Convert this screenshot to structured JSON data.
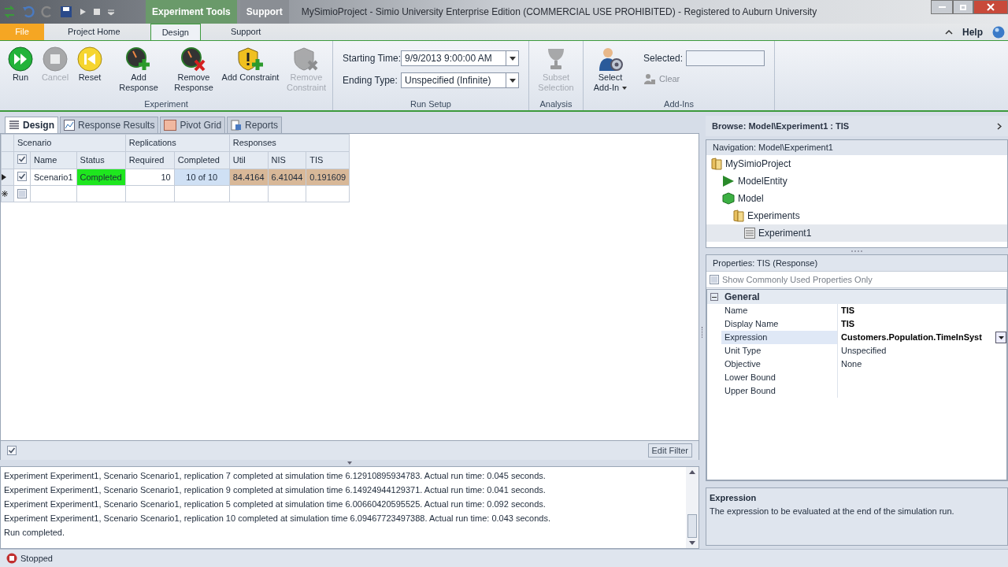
{
  "title_bar": {
    "contextual_tabs": [
      {
        "label": "Experiment Tools",
        "selected": true
      },
      {
        "label": "Support",
        "selected": false
      }
    ],
    "title": "MySimioProject - Simio University Enterprise Edition (COMMERCIAL USE PROHIBITED) - Registered to Auburn University"
  },
  "ribbon_tabs": [
    {
      "label": "File",
      "kind": "file",
      "selected": false
    },
    {
      "label": "Project Home",
      "kind": "tab",
      "selected": false
    },
    {
      "label": "Design",
      "kind": "tab",
      "selected": true
    },
    {
      "label": "Support",
      "kind": "tab",
      "selected": false
    }
  ],
  "help": "Help",
  "ribbon_groups": [
    {
      "label": "Experiment",
      "kind": "buttons",
      "buttons": [
        {
          "label": "Run",
          "disabled": false
        },
        {
          "label": "Cancel",
          "disabled": true
        },
        {
          "label": "Reset",
          "disabled": false
        },
        {
          "label": "Add Response",
          "disabled": false
        },
        {
          "label": "Remove Response",
          "disabled": false
        },
        {
          "label": "Add Constraint",
          "disabled": false
        },
        {
          "label": "Remove Constraint",
          "disabled": true
        }
      ]
    },
    {
      "label": "Run Setup",
      "kind": "fields",
      "fields": [
        {
          "label": "Starting Time:",
          "value": "9/9/2013 9:00:00 AM"
        },
        {
          "label": "Ending Type:",
          "value": "Unspecified (Infinite)"
        }
      ]
    },
    {
      "label": "Analysis",
      "kind": "buttons",
      "buttons": [
        {
          "label": "Subset Selection",
          "disabled": true
        }
      ]
    },
    {
      "label": "Add-Ins",
      "kind": "addins",
      "buttons": [
        {
          "label": "Select Add-In",
          "disabled": false
        }
      ],
      "selected_label": "Selected:",
      "clear": {
        "label": "Clear",
        "disabled": true
      }
    }
  ],
  "doc_tabs": [
    {
      "label": "Design",
      "selected": true
    },
    {
      "label": "Response Results",
      "selected": false
    },
    {
      "label": "Pivot Grid",
      "selected": false
    },
    {
      "label": "Reports",
      "selected": false
    }
  ],
  "grid": {
    "column_groups": [
      {
        "label": "Scenario",
        "columns": [
          {
            "kind": "check",
            "checked": true
          },
          {
            "kind": "text",
            "label": "Name"
          },
          {
            "kind": "status",
            "label": "Status"
          }
        ]
      },
      {
        "label": "Replications",
        "columns": [
          {
            "kind": "number",
            "label": "Required"
          },
          {
            "kind": "progress",
            "label": "Completed"
          }
        ]
      },
      {
        "label": "Responses",
        "columns": [
          {
            "kind": "response",
            "label": "Util"
          },
          {
            "kind": "response",
            "label": "NIS"
          },
          {
            "kind": "response",
            "label": "TIS"
          }
        ]
      }
    ],
    "rows": [
      {
        "kind": "current",
        "checked": true,
        "cells": [
          {
            "text": "Scenario1"
          },
          {
            "text": "Completed",
            "color": "#1ee61e"
          },
          {
            "text": "10"
          },
          {
            "text": "10 of 10"
          },
          {
            "text": "84.4164"
          },
          {
            "text": "6.41044"
          },
          {
            "text": "0.191609"
          }
        ]
      },
      {
        "kind": "new",
        "checked": false
      }
    ]
  },
  "filter_bar": {
    "checked": true,
    "button": "Edit Filter"
  },
  "log": [
    "Experiment Experiment1, Scenario Scenario1, replication 7 completed at simulation time 6.12910895934783.  Actual run time: 0.045 seconds.",
    "Experiment Experiment1, Scenario Scenario1, replication 9 completed at simulation time 6.14924944129371.  Actual run time: 0.041 seconds.",
    "Experiment Experiment1, Scenario Scenario1, replication 5 completed at simulation time 6.00660420595525.  Actual run time: 0.092 seconds.",
    "Experiment Experiment1, Scenario Scenario1, replication 10 completed at simulation time 6.09467723497388.  Actual run time: 0.043 seconds.",
    "Run completed."
  ],
  "status_bar": {
    "state": "Stopped"
  },
  "browse": {
    "title": "Browse: Model\\Experiment1 : TIS",
    "navigation": "Navigation: Model\\Experiment1",
    "tree": [
      {
        "label": "MySimioProject",
        "kind": "folder",
        "selected": false,
        "children": [
          {
            "label": "ModelEntity",
            "kind": "entity",
            "selected": false
          },
          {
            "label": "Model",
            "kind": "model",
            "selected": false,
            "children": [
              {
                "label": "Experiments",
                "kind": "folder",
                "selected": false,
                "children": [
                  {
                    "label": "Experiment1",
                    "kind": "experiment",
                    "selected": true
                  }
                ]
              }
            ]
          }
        ]
      }
    ]
  },
  "properties": {
    "title": "Properties: TIS (Response)",
    "common_only": {
      "label": "Show Commonly Used Properties Only",
      "checked": false
    },
    "category": {
      "label": "General",
      "expanded": true
    },
    "rows": [
      {
        "name": "Name",
        "value": "TIS",
        "bold": true,
        "selected": false,
        "kind": "text"
      },
      {
        "name": "Display Name",
        "value": "TIS",
        "bold": true,
        "selected": false,
        "kind": "text"
      },
      {
        "name": "Expression",
        "value": "Customers.Population.TimeInSyst",
        "bold": true,
        "selected": true,
        "kind": "dropdown"
      },
      {
        "name": "Unit Type",
        "value": "Unspecified",
        "bold": false,
        "selected": false,
        "kind": "text"
      },
      {
        "name": "Objective",
        "value": "None",
        "bold": false,
        "selected": false,
        "kind": "text"
      },
      {
        "name": "Lower Bound",
        "selected": false,
        "kind": "text"
      },
      {
        "name": "Upper Bound",
        "selected": false,
        "kind": "text"
      }
    ],
    "description": {
      "title": "Expression",
      "text": "The expression to be evaluated at the end of the simulation run."
    }
  }
}
